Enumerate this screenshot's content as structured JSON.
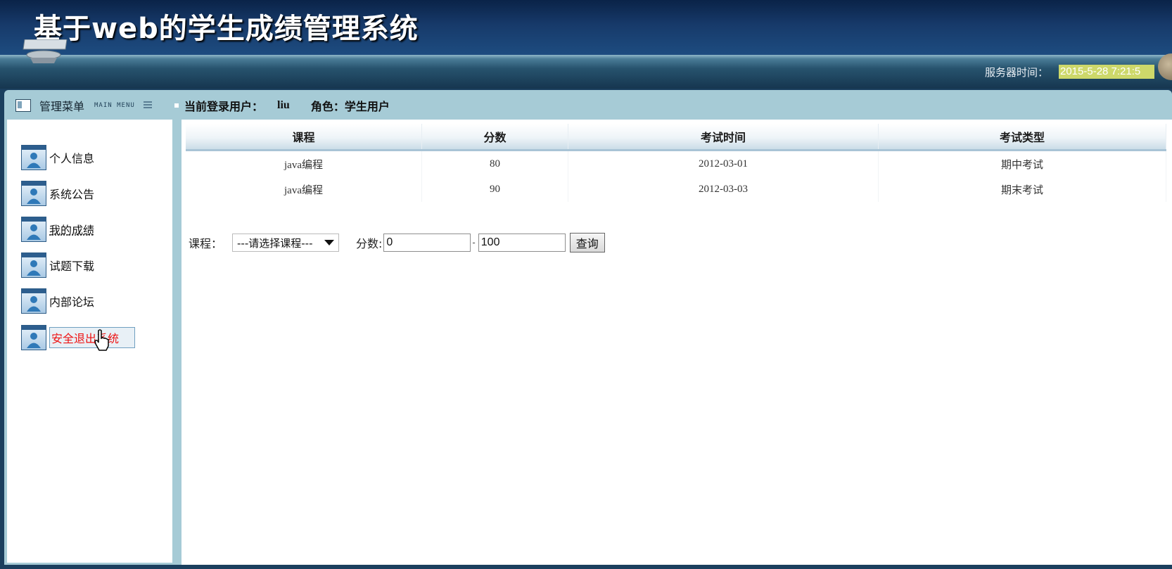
{
  "header": {
    "title": "基于web的学生成绩管理系统"
  },
  "server": {
    "label": "服务器时间：",
    "time": "2015-5-28 7:21:5"
  },
  "sidebar": {
    "title": "管理菜单",
    "subtitle": "MAIN MENU",
    "items": [
      {
        "label": "个人信息"
      },
      {
        "label": "系统公告"
      },
      {
        "label": "我的成绩"
      },
      {
        "label": "试题下载"
      },
      {
        "label": "内部论坛"
      },
      {
        "label": "安全退出系统"
      }
    ]
  },
  "session": {
    "user_label": "当前登录用户：",
    "user": "liu",
    "role_label": "角色：学生用户"
  },
  "table": {
    "headers": [
      "课程",
      "分数",
      "考试时间",
      "考试类型"
    ],
    "rows": [
      [
        "java编程",
        "80",
        "2012-03-01",
        "期中考试"
      ],
      [
        "java编程",
        "90",
        "2012-03-03",
        "期末考试"
      ]
    ]
  },
  "search": {
    "course_label": "课程：",
    "course_selected": "---请选择课程---",
    "score_label": "分数:",
    "score_min": "0",
    "score_max": "100",
    "dash": "-",
    "button": "查询"
  }
}
